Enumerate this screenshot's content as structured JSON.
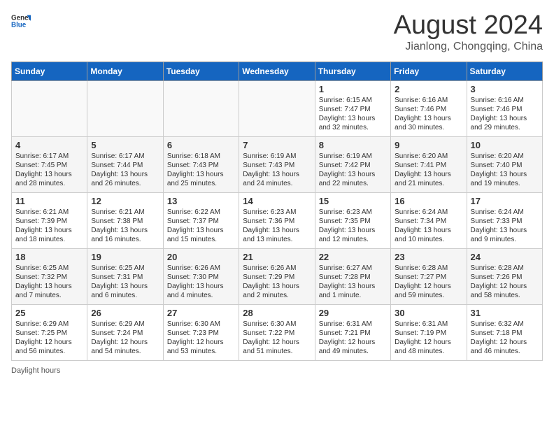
{
  "header": {
    "logo_general": "General",
    "logo_blue": "Blue",
    "main_title": "August 2024",
    "subtitle": "Jianlong, Chongqing, China"
  },
  "days_of_week": [
    "Sunday",
    "Monday",
    "Tuesday",
    "Wednesday",
    "Thursday",
    "Friday",
    "Saturday"
  ],
  "weeks": [
    [
      {
        "date": "",
        "info": ""
      },
      {
        "date": "",
        "info": ""
      },
      {
        "date": "",
        "info": ""
      },
      {
        "date": "",
        "info": ""
      },
      {
        "date": "1",
        "info": "Sunrise: 6:15 AM\nSunset: 7:47 PM\nDaylight: 13 hours\nand 32 minutes."
      },
      {
        "date": "2",
        "info": "Sunrise: 6:16 AM\nSunset: 7:46 PM\nDaylight: 13 hours\nand 30 minutes."
      },
      {
        "date": "3",
        "info": "Sunrise: 6:16 AM\nSunset: 7:46 PM\nDaylight: 13 hours\nand 29 minutes."
      }
    ],
    [
      {
        "date": "4",
        "info": "Sunrise: 6:17 AM\nSunset: 7:45 PM\nDaylight: 13 hours\nand 28 minutes."
      },
      {
        "date": "5",
        "info": "Sunrise: 6:17 AM\nSunset: 7:44 PM\nDaylight: 13 hours\nand 26 minutes."
      },
      {
        "date": "6",
        "info": "Sunrise: 6:18 AM\nSunset: 7:43 PM\nDaylight: 13 hours\nand 25 minutes."
      },
      {
        "date": "7",
        "info": "Sunrise: 6:19 AM\nSunset: 7:43 PM\nDaylight: 13 hours\nand 24 minutes."
      },
      {
        "date": "8",
        "info": "Sunrise: 6:19 AM\nSunset: 7:42 PM\nDaylight: 13 hours\nand 22 minutes."
      },
      {
        "date": "9",
        "info": "Sunrise: 6:20 AM\nSunset: 7:41 PM\nDaylight: 13 hours\nand 21 minutes."
      },
      {
        "date": "10",
        "info": "Sunrise: 6:20 AM\nSunset: 7:40 PM\nDaylight: 13 hours\nand 19 minutes."
      }
    ],
    [
      {
        "date": "11",
        "info": "Sunrise: 6:21 AM\nSunset: 7:39 PM\nDaylight: 13 hours\nand 18 minutes."
      },
      {
        "date": "12",
        "info": "Sunrise: 6:21 AM\nSunset: 7:38 PM\nDaylight: 13 hours\nand 16 minutes."
      },
      {
        "date": "13",
        "info": "Sunrise: 6:22 AM\nSunset: 7:37 PM\nDaylight: 13 hours\nand 15 minutes."
      },
      {
        "date": "14",
        "info": "Sunrise: 6:23 AM\nSunset: 7:36 PM\nDaylight: 13 hours\nand 13 minutes."
      },
      {
        "date": "15",
        "info": "Sunrise: 6:23 AM\nSunset: 7:35 PM\nDaylight: 13 hours\nand 12 minutes."
      },
      {
        "date": "16",
        "info": "Sunrise: 6:24 AM\nSunset: 7:34 PM\nDaylight: 13 hours\nand 10 minutes."
      },
      {
        "date": "17",
        "info": "Sunrise: 6:24 AM\nSunset: 7:33 PM\nDaylight: 13 hours\nand 9 minutes."
      }
    ],
    [
      {
        "date": "18",
        "info": "Sunrise: 6:25 AM\nSunset: 7:32 PM\nDaylight: 13 hours\nand 7 minutes."
      },
      {
        "date": "19",
        "info": "Sunrise: 6:25 AM\nSunset: 7:31 PM\nDaylight: 13 hours\nand 6 minutes."
      },
      {
        "date": "20",
        "info": "Sunrise: 6:26 AM\nSunset: 7:30 PM\nDaylight: 13 hours\nand 4 minutes."
      },
      {
        "date": "21",
        "info": "Sunrise: 6:26 AM\nSunset: 7:29 PM\nDaylight: 13 hours\nand 2 minutes."
      },
      {
        "date": "22",
        "info": "Sunrise: 6:27 AM\nSunset: 7:28 PM\nDaylight: 13 hours\nand 1 minute."
      },
      {
        "date": "23",
        "info": "Sunrise: 6:28 AM\nSunset: 7:27 PM\nDaylight: 12 hours\nand 59 minutes."
      },
      {
        "date": "24",
        "info": "Sunrise: 6:28 AM\nSunset: 7:26 PM\nDaylight: 12 hours\nand 58 minutes."
      }
    ],
    [
      {
        "date": "25",
        "info": "Sunrise: 6:29 AM\nSunset: 7:25 PM\nDaylight: 12 hours\nand 56 minutes."
      },
      {
        "date": "26",
        "info": "Sunrise: 6:29 AM\nSunset: 7:24 PM\nDaylight: 12 hours\nand 54 minutes."
      },
      {
        "date": "27",
        "info": "Sunrise: 6:30 AM\nSunset: 7:23 PM\nDaylight: 12 hours\nand 53 minutes."
      },
      {
        "date": "28",
        "info": "Sunrise: 6:30 AM\nSunset: 7:22 PM\nDaylight: 12 hours\nand 51 minutes."
      },
      {
        "date": "29",
        "info": "Sunrise: 6:31 AM\nSunset: 7:21 PM\nDaylight: 12 hours\nand 49 minutes."
      },
      {
        "date": "30",
        "info": "Sunrise: 6:31 AM\nSunset: 7:19 PM\nDaylight: 12 hours\nand 48 minutes."
      },
      {
        "date": "31",
        "info": "Sunrise: 6:32 AM\nSunset: 7:18 PM\nDaylight: 12 hours\nand 46 minutes."
      }
    ]
  ],
  "footer": {
    "daylight_label": "Daylight hours"
  }
}
